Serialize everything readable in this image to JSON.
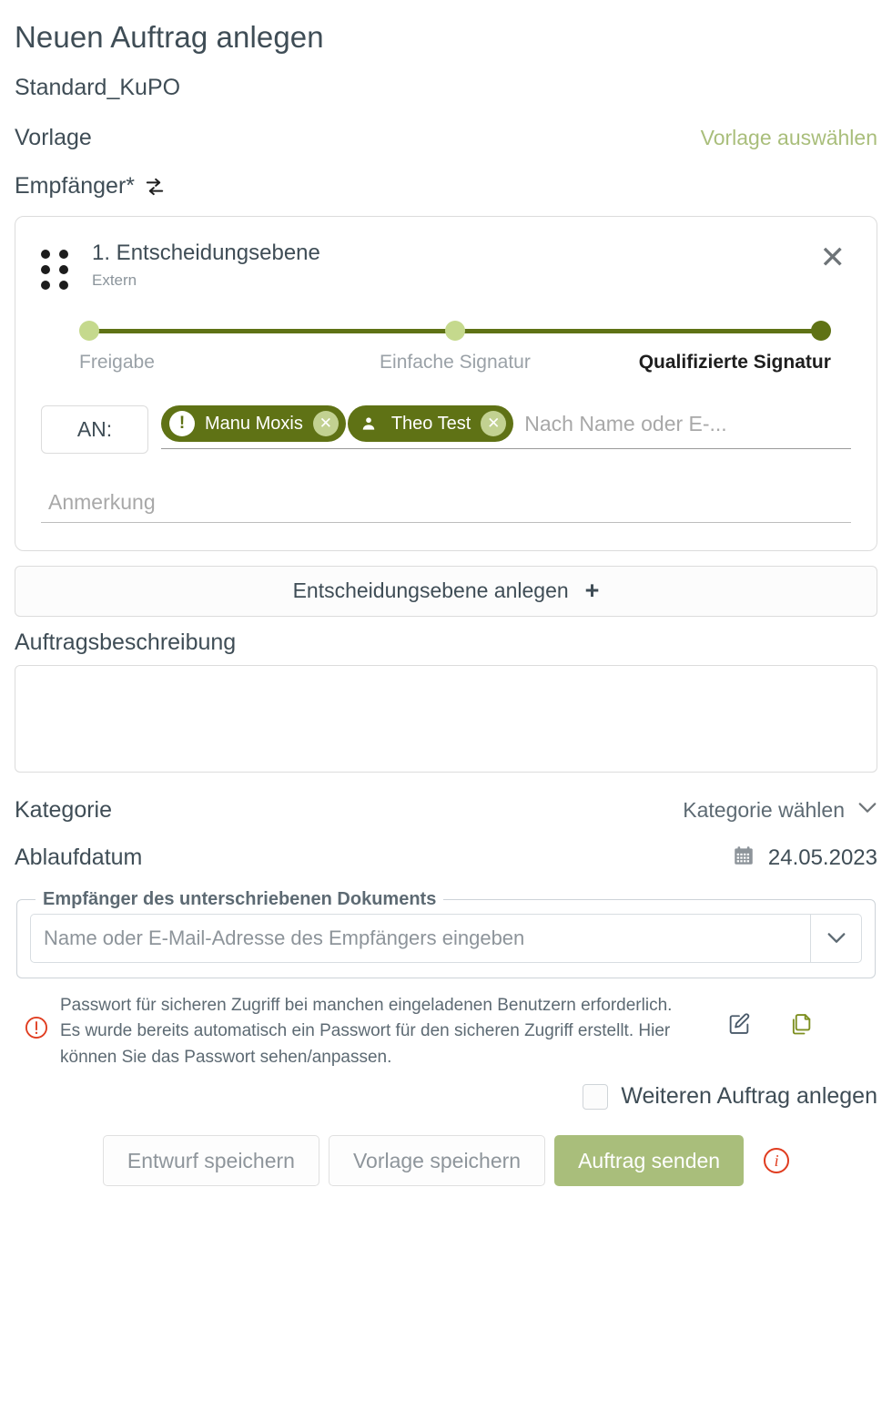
{
  "header": {
    "title": "Neuen Auftrag anlegen",
    "subtitle": "Standard_KuPO"
  },
  "template_row": {
    "label": "Vorlage",
    "action": "Vorlage auswählen"
  },
  "recipients_row": {
    "label": "Empfänger*",
    "swap_icon": "swap-arrows-icon"
  },
  "level_card": {
    "drag_icon": "drag-handle-icon",
    "title": "1. Entscheidungsebene",
    "subtitle": "Extern",
    "close_icon": "close-icon",
    "stepper": {
      "steps": [
        {
          "label": "Freigabe",
          "active": false
        },
        {
          "label": "Einfache Signatur",
          "active": false
        },
        {
          "label": "Qualifizierte Signatur",
          "active": true
        }
      ]
    },
    "to_label": "AN:",
    "chips": [
      {
        "name": "Manu Moxis",
        "icon": "alert-exclamation-icon",
        "remove_icon": "remove-icon"
      },
      {
        "name": "Theo Test",
        "icon": "person-icon",
        "remove_icon": "remove-icon"
      }
    ],
    "recipient_input_placeholder": "Nach Name oder E-...",
    "recipient_input_value": "",
    "note_placeholder": "Anmerkung",
    "note_value": ""
  },
  "add_level": {
    "label": "Entscheidungsebene anlegen",
    "icon": "plus-icon"
  },
  "description": {
    "label": "Auftragsbeschreibung",
    "value": "",
    "placeholder": ""
  },
  "category": {
    "label": "Kategorie",
    "value": "Kategorie wählen",
    "icon": "chevron-down-icon"
  },
  "expiry": {
    "label": "Ablaufdatum",
    "value": "24.05.2023",
    "icon": "calendar-icon"
  },
  "signed_doc_recipient": {
    "legend": "Empfänger des unterschriebenen Dokuments",
    "placeholder": "Name oder E-Mail-Adresse des Empfängers eingeben",
    "value": "",
    "icon": "chevron-down-icon"
  },
  "password_notice": {
    "icon": "warning-exclamation-icon",
    "line1": "Passwort für sicheren Zugriff bei manchen eingeladenen Benutzern erforderlich.",
    "line2": "Es wurde bereits automatisch ein Passwort für den sicheren Zugriff erstellt. Hier können Sie das Passwort sehen/anpassen.",
    "edit_icon": "edit-pencil-icon",
    "copy_icon": "copy-icon"
  },
  "another_order": {
    "label": "Weiteren Auftrag anlegen",
    "checked": false
  },
  "footer": {
    "save_draft": "Entwurf speichern",
    "save_template": "Vorlage speichern",
    "send": "Auftrag senden",
    "info_icon": "info-icon",
    "info_glyph": "i"
  },
  "colors": {
    "accent_dark": "#5f7215",
    "accent_light": "#c5d98d",
    "primary_button": "#a9be7b",
    "link": "#a9be7b",
    "warning": "#e03c1f",
    "text": "#3f4d56",
    "muted": "#8b949b"
  }
}
